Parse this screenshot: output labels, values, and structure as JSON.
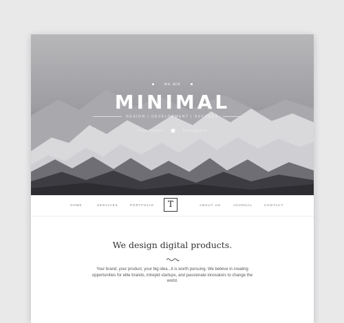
{
  "hero": {
    "kicker": "we are",
    "title": "MINIMAL",
    "tagline": "DESIGN | DEVELOPMENT | SUCCESS",
    "byline_left": "Copenhagen",
    "byline_right": "Portuguese",
    "tiny_line": "ML + LT"
  },
  "nav": {
    "items_left": [
      "HOME",
      "SERVICES",
      "PORTFOLIO"
    ],
    "logo_letter": "T",
    "items_right": [
      "ABOUT US",
      "JOURNAL",
      "CONTACT"
    ]
  },
  "content": {
    "headline": "We design digital products.",
    "body": "Your brand, your product, your big idea...it is worth pursuing. We believe in creating opportunities for elite brands, intrepid startups, and passionate innovators to change the world."
  },
  "colors": {
    "background": "#e9e9ea",
    "hero_top": "#b7b7ba",
    "hero_bottom": "#44444a",
    "text_dark": "#333333"
  },
  "icons": [
    "star-icon",
    "logo-mark-icon",
    "squiggle-divider-icon"
  ]
}
